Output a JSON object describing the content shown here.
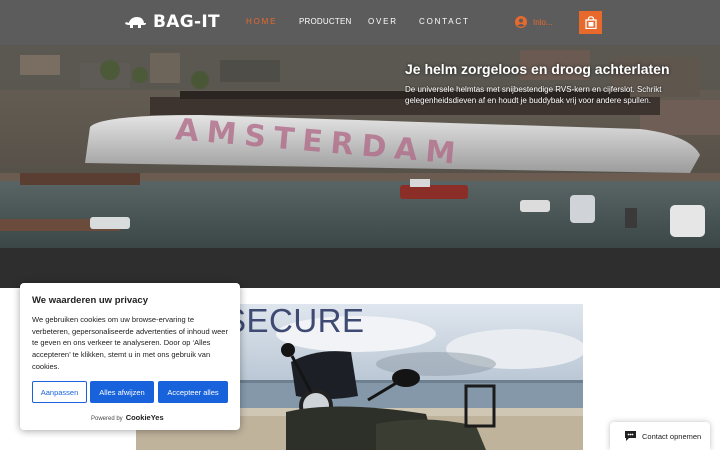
{
  "header": {
    "brand": "BAG-IT",
    "nav": [
      {
        "label": "HOME",
        "active": true
      },
      {
        "label": "PRODUCTEN",
        "active": false
      },
      {
        "label": "OVER",
        "active": false
      },
      {
        "label": "CONTACT",
        "active": false
      }
    ],
    "login_label": "Inlo...",
    "login_icon": "user-circle-icon",
    "cart_icon": "shopping-bag-icon",
    "accent_color": "#e8692c",
    "background_color": "#5c5c5c"
  },
  "hero": {
    "title": "Je helm zorgeloos en droog achterlaten",
    "text": "De universele helmtas met snijbestendige RVS-kern en cijferslot. Schrikt gelegenheidsdieven af en houdt je buddybak vrij voor andere spullen.",
    "image_sign": "AMSTERDAM"
  },
  "product": {
    "image_title": "SECURE"
  },
  "cookie_banner": {
    "title": "We waarderen uw privacy",
    "body": "We gebruiken cookies om uw browse-ervaring te verbeteren, gepersonaliseerde advertenties of inhoud weer te geven en ons verkeer te analyseren. Door op ‘Alles accepteren’ te klikken, stemt u in met ons gebruik van cookies.",
    "buttons": {
      "customize": "Aanpassen",
      "reject": "Alles afwijzen",
      "accept": "Accepteer alles"
    },
    "powered_by": "Powered by",
    "powered_brand": "CookieYes",
    "button_color": "#1863dc"
  },
  "contact_chip": {
    "label": "Contact opnemen",
    "icon": "chat-bubble-icon"
  }
}
